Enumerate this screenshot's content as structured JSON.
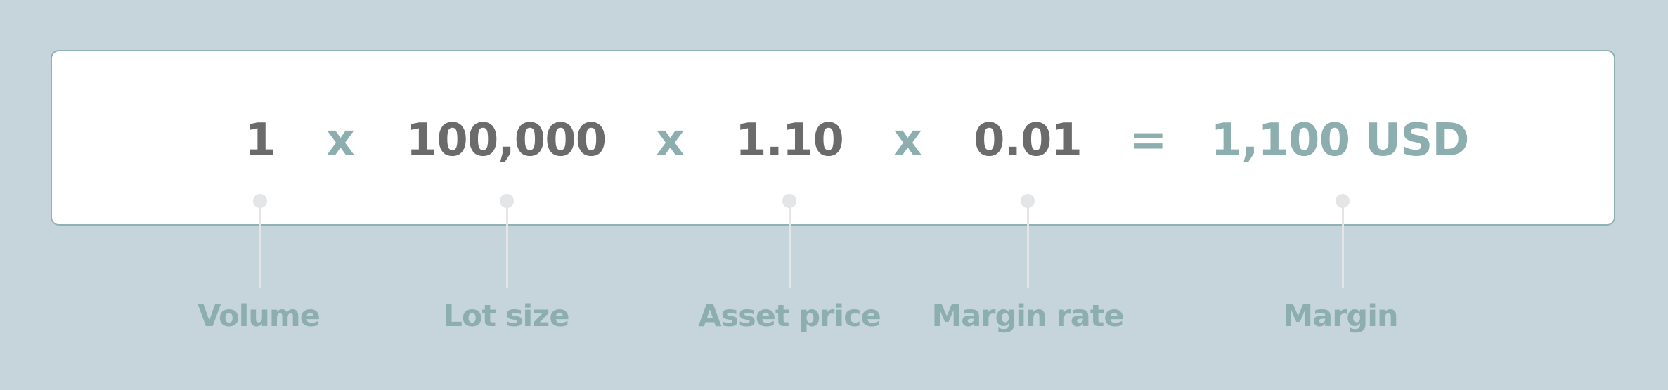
{
  "formula": {
    "volume": "1",
    "op1": "x",
    "lot_size": "100,000",
    "op2": "x",
    "asset_price": "1.10",
    "op3": "x",
    "margin_rate": "0.01",
    "equals": "=",
    "result": "1,100 USD"
  },
  "labels": {
    "volume": "Volume",
    "lot_size": "Lot size",
    "asset_price": "Asset price",
    "margin_rate": "Margin rate",
    "margin": "Margin"
  },
  "colors": {
    "background": "#c6d5db",
    "card": "#ffffff",
    "value_text": "#6b6b6b",
    "accent": "#8daeae",
    "connector": "#e3e5e6"
  }
}
